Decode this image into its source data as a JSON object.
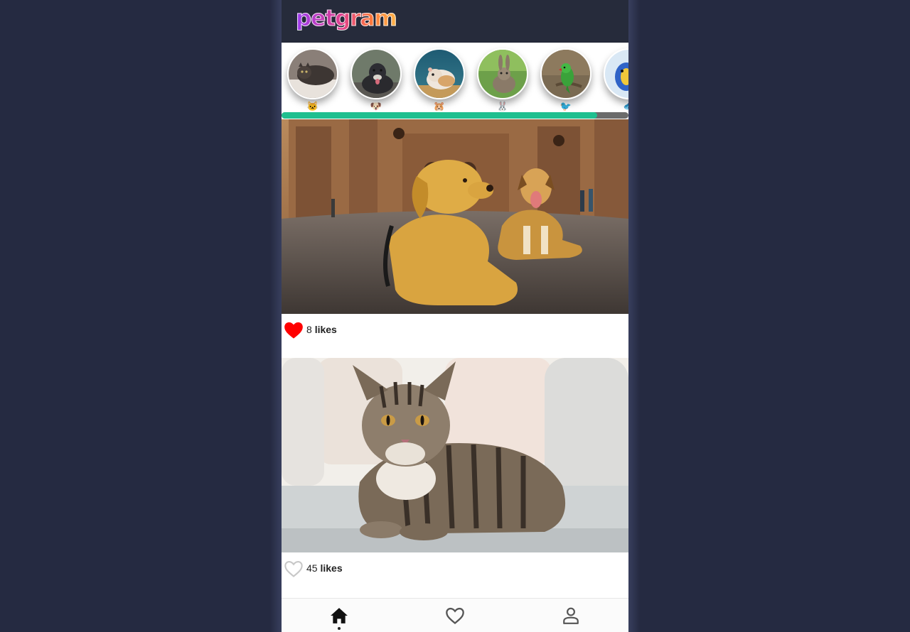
{
  "app": {
    "logo_text": "petgram"
  },
  "stories": [
    {
      "name": "cat-story",
      "emoji": "🐱"
    },
    {
      "name": "dog-story",
      "emoji": "🐶"
    },
    {
      "name": "hamster-story",
      "emoji": "🐹"
    },
    {
      "name": "rabbit-story",
      "emoji": "🐰"
    },
    {
      "name": "bird-story",
      "emoji": "🐦"
    },
    {
      "name": "fish-story",
      "emoji": "🐟"
    }
  ],
  "stories_scroll": {
    "visible_fraction": 0.91
  },
  "posts": [
    {
      "image_subject": "two dogs lying in front of a cathedral",
      "likes": "8",
      "likes_label": "likes",
      "liked": true
    },
    {
      "image_subject": "tabby cat lying on a sofa",
      "likes": "45",
      "likes_label": "likes",
      "liked": false
    }
  ],
  "nav": {
    "items": [
      {
        "icon": "home-icon",
        "active": true
      },
      {
        "icon": "heart-icon",
        "active": false
      },
      {
        "icon": "user-icon",
        "active": false
      }
    ]
  },
  "colors": {
    "background": "#252a41",
    "topbar": "#262b3b",
    "accent_scroll": "#1fbf8f",
    "like_red": "#ff0000"
  }
}
